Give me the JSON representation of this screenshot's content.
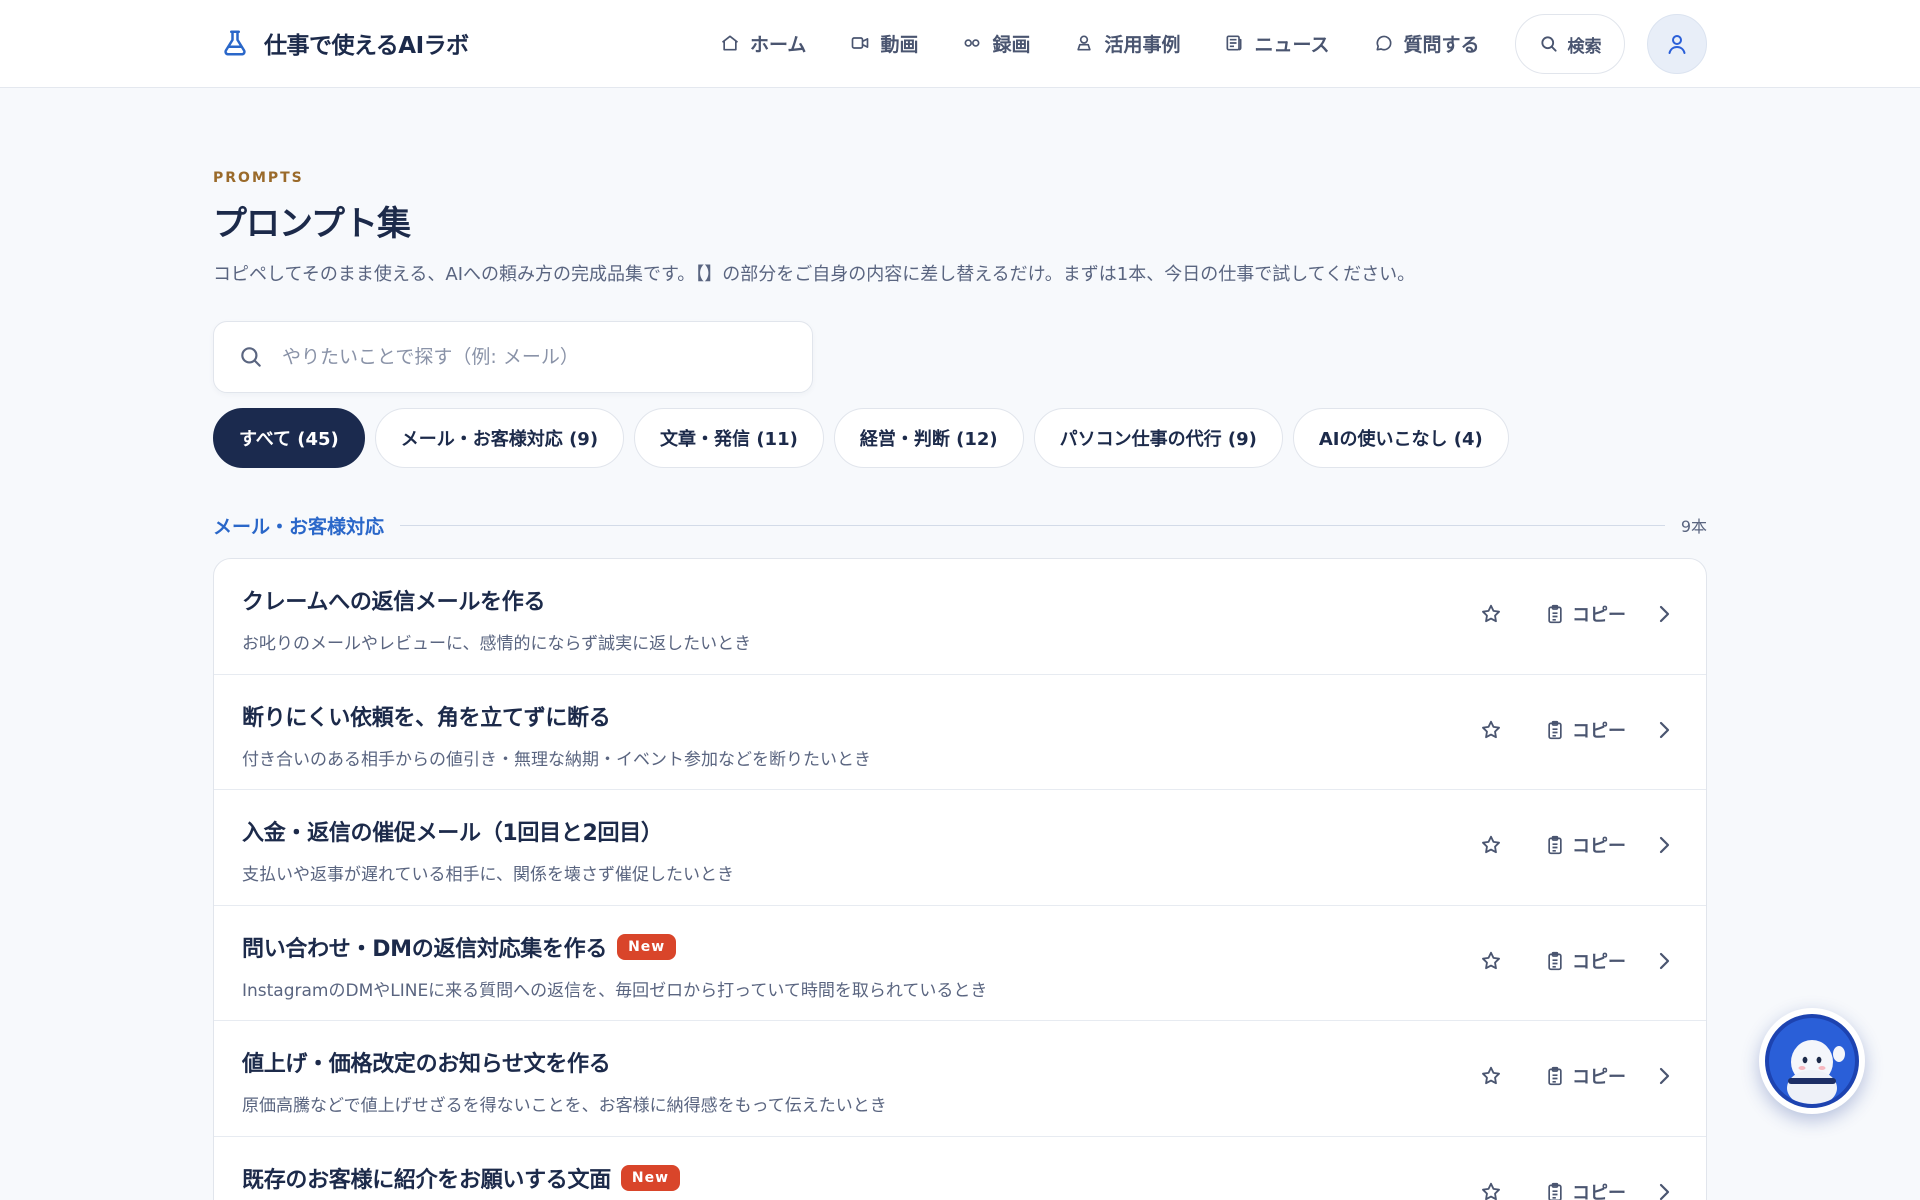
{
  "header": {
    "brand": "仕事で使えるAIラボ",
    "nav": [
      {
        "label": "ホーム",
        "icon": "home-icon"
      },
      {
        "label": "動画",
        "icon": "video-icon"
      },
      {
        "label": "録画",
        "icon": "infinity-icon"
      },
      {
        "label": "活用事例",
        "icon": "award-icon"
      },
      {
        "label": "ニュース",
        "icon": "newspaper-icon"
      },
      {
        "label": "質問する",
        "icon": "chat-icon"
      }
    ],
    "search_label": "検索"
  },
  "main": {
    "eyebrow": "PROMPTS",
    "title": "プロンプト集",
    "description": "コピペしてそのまま使える、AIへの頼み方の完成品集です。【】の部分をご自身の内容に差し替えるだけ。まずは1本、今日の仕事で試してください。",
    "search": {
      "placeholder": "やりたいことで探す（例: メール）",
      "value": ""
    },
    "filters": [
      {
        "label": "すべて (45)",
        "active": true
      },
      {
        "label": "メール・お客様対応 (9)",
        "active": false
      },
      {
        "label": "文章・発信 (11)",
        "active": false
      },
      {
        "label": "経営・判断 (12)",
        "active": false
      },
      {
        "label": "パソコン仕事の代行 (9)",
        "active": false
      },
      {
        "label": "AIの使いこなし (4)",
        "active": false
      }
    ],
    "section": {
      "title": "メール・お客様対応",
      "count": "9本",
      "items": [
        {
          "title": "クレームへの返信メールを作る",
          "subtitle": "お叱りのメールやレビューに、感情的にならず誠実に返したいとき",
          "badge": "",
          "copy_label": "コピー"
        },
        {
          "title": "断りにくい依頼を、角を立てずに断る",
          "subtitle": "付き合いのある相手からの値引き・無理な納期・イベント参加などを断りたいとき",
          "badge": "",
          "copy_label": "コピー"
        },
        {
          "title": "入金・返信の催促メール（1回目と2回目）",
          "subtitle": "支払いや返事が遅れている相手に、関係を壊さず催促したいとき",
          "badge": "",
          "copy_label": "コピー"
        },
        {
          "title": "問い合わせ・DMの返信対応集を作る",
          "subtitle": "InstagramのDMやLINEに来る質問への返信を、毎回ゼロから打っていて時間を取られているとき",
          "badge": "New",
          "copy_label": "コピー"
        },
        {
          "title": "値上げ・価格改定のお知らせ文を作る",
          "subtitle": "原価高騰などで値上げせざるを得ないことを、お客様に納得感をもって伝えたいとき",
          "badge": "",
          "copy_label": "コピー"
        },
        {
          "title": "既存のお客様に紹介をお願いする文面",
          "subtitle": "",
          "badge": "New",
          "copy_label": "コピー"
        }
      ]
    }
  },
  "colors": {
    "navy": "#1b2a4e",
    "accent_blue": "#2a67c9",
    "eyebrow_gold": "#9a6a2a",
    "new_badge": "#d9452a"
  }
}
